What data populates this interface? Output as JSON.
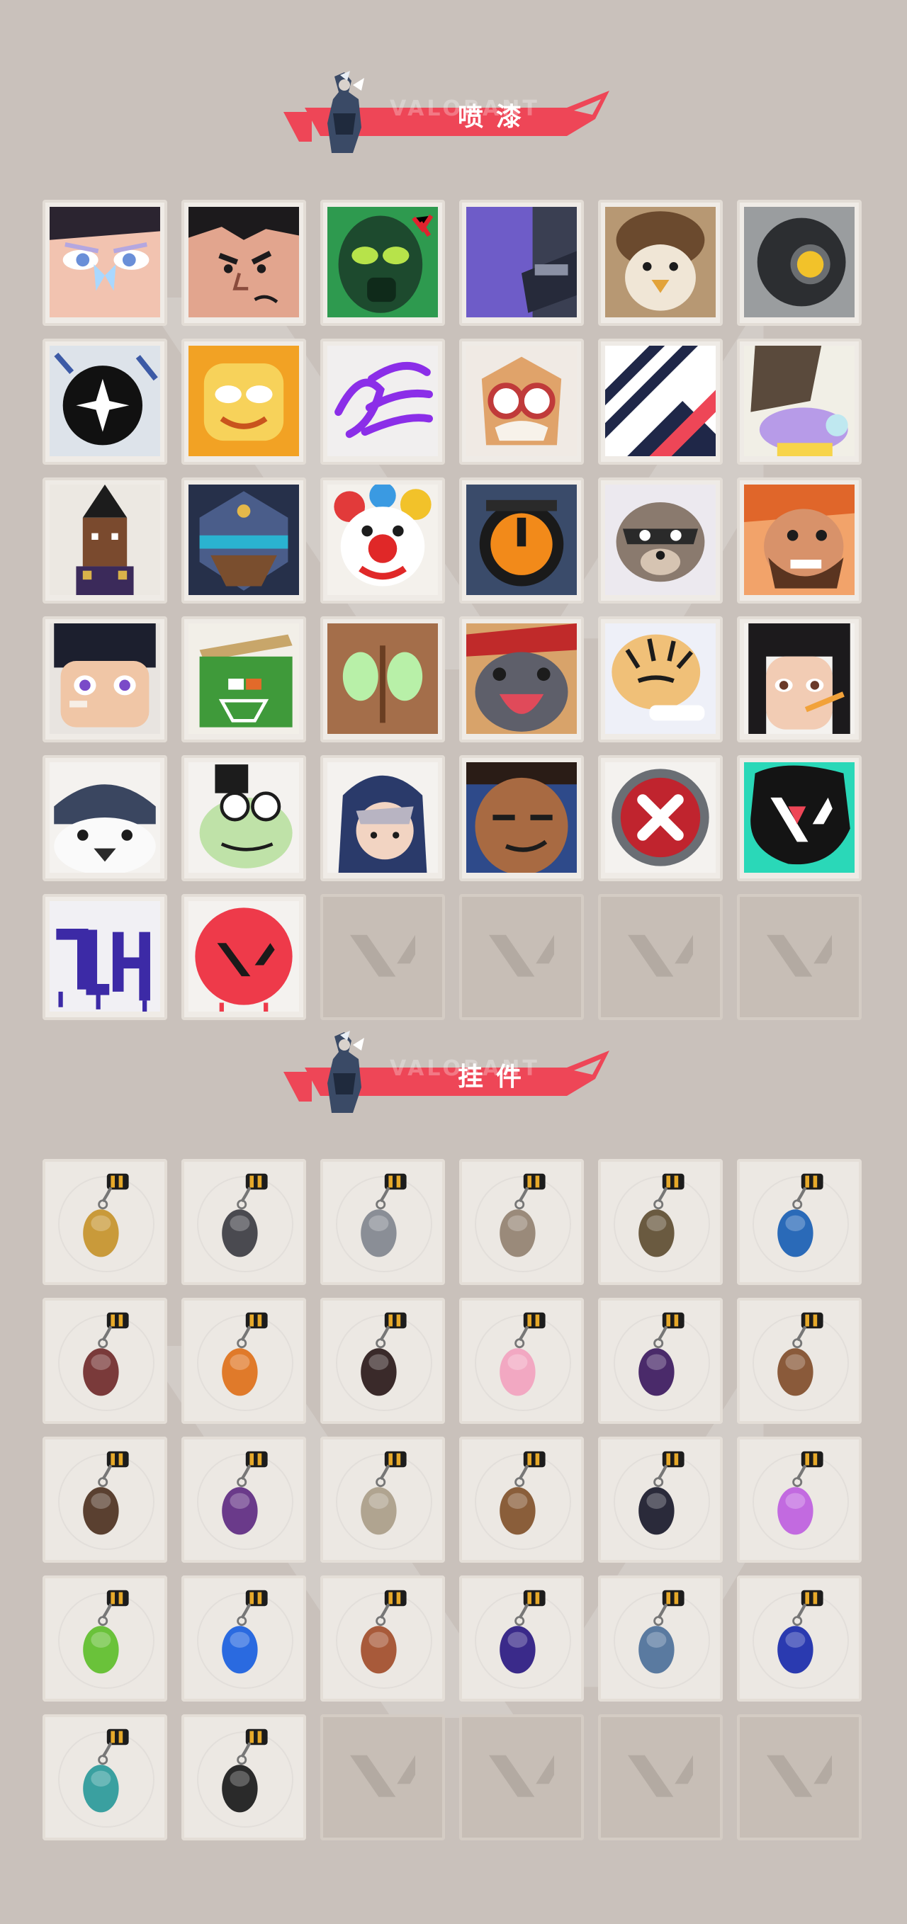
{
  "sections": {
    "sprays": {
      "title": "喷漆"
    },
    "buddies": {
      "title": "挂件"
    }
  },
  "banner_watermark": "VALORANT",
  "colors": {
    "background": "#c9c1bb",
    "banner_red": "#ee4657",
    "tile_bg": "#efebe6",
    "empty_tile": "#c7beb6"
  },
  "sprays": [
    {
      "icon": "girl-butterfly-face-spray-icon"
    },
    {
      "icon": "angry-cartoon-face-spray-icon"
    },
    {
      "icon": "green-gasmask-spray-icon"
    },
    {
      "icon": "purple-robot-spray-icon"
    },
    {
      "icon": "beanie-penguin-spray-icon"
    },
    {
      "icon": "kayo-robot-eye-spray-icon"
    },
    {
      "icon": "black-star-badge-spray-icon"
    },
    {
      "icon": "golden-mask-spray-icon"
    },
    {
      "icon": "purple-scribble-spray-icon"
    },
    {
      "icon": "goggles-cat-spray-icon"
    },
    {
      "icon": "chevron-stripes-spray-icon"
    },
    {
      "icon": "purple-creature-hat-spray-icon"
    },
    {
      "icon": "pixel-agent-spray-icon"
    },
    {
      "icon": "armored-helmet-spray-icon"
    },
    {
      "icon": "clown-face-spray-icon"
    },
    {
      "icon": "orange-dial-spray-icon"
    },
    {
      "icon": "raccoon-spray-icon"
    },
    {
      "icon": "bearded-man-spray-icon"
    },
    {
      "icon": "bandaged-boy-spray-icon"
    },
    {
      "icon": "green-crate-spray-icon"
    },
    {
      "icon": "green-eyes-creature-spray-icon"
    },
    {
      "icon": "crying-seal-spray-icon"
    },
    {
      "icon": "tiger-spray-icon"
    },
    {
      "icon": "girl-pencil-spray-icon"
    },
    {
      "icon": "beanie-penguin-close-spray-icon"
    },
    {
      "icon": "frog-top-hat-spray-icon"
    },
    {
      "icon": "hooded-agent-spray-icon"
    },
    {
      "icon": "smirk-face-spray-icon"
    },
    {
      "icon": "red-x-button-spray-icon"
    },
    {
      "icon": "valorant-splash-spray-icon"
    },
    {
      "icon": "purple-graffiti-spray-icon"
    },
    {
      "icon": "red-valorant-circle-spray-icon"
    }
  ],
  "buddies": [
    {
      "icon": "golden-bear-buddy-icon"
    },
    {
      "icon": "robot-drone-buddy-icon"
    },
    {
      "icon": "gift-box-buddy-icon"
    },
    {
      "icon": "cat-soldier-buddy-icon"
    },
    {
      "icon": "round-bag-buddy-icon"
    },
    {
      "icon": "blue-bottle-buddy-icon"
    },
    {
      "icon": "spiked-sword-buddy-icon"
    },
    {
      "icon": "orange-pepper-buddy-icon"
    },
    {
      "icon": "rope-knot-buddy-icon"
    },
    {
      "icon": "cupcake-buddy-icon"
    },
    {
      "icon": "ep9-medallion-buddy-icon"
    },
    {
      "icon": "boxing-bear-buddy-icon"
    },
    {
      "icon": "wooden-tool-buddy-icon"
    },
    {
      "icon": "agent-figure-buddy-icon"
    },
    {
      "icon": "cowboy-figure-buddy-icon"
    },
    {
      "icon": "wooden-crate-buddy-icon"
    },
    {
      "icon": "reaper-figure-buddy-icon"
    },
    {
      "icon": "lava-lamp-buddy-icon"
    },
    {
      "icon": "green-gameboy-buddy-icon"
    },
    {
      "icon": "astronaut-buddy-icon"
    },
    {
      "icon": "radio-device-buddy-icon"
    },
    {
      "icon": "ep9-medallion-purple-buddy-icon"
    },
    {
      "icon": "agent-card-buddy-icon"
    },
    {
      "icon": "ep9-medallion-blue-buddy-icon"
    },
    {
      "icon": "ufo-buddy-icon"
    },
    {
      "icon": "valorant-medallion-buddy-icon"
    }
  ]
}
